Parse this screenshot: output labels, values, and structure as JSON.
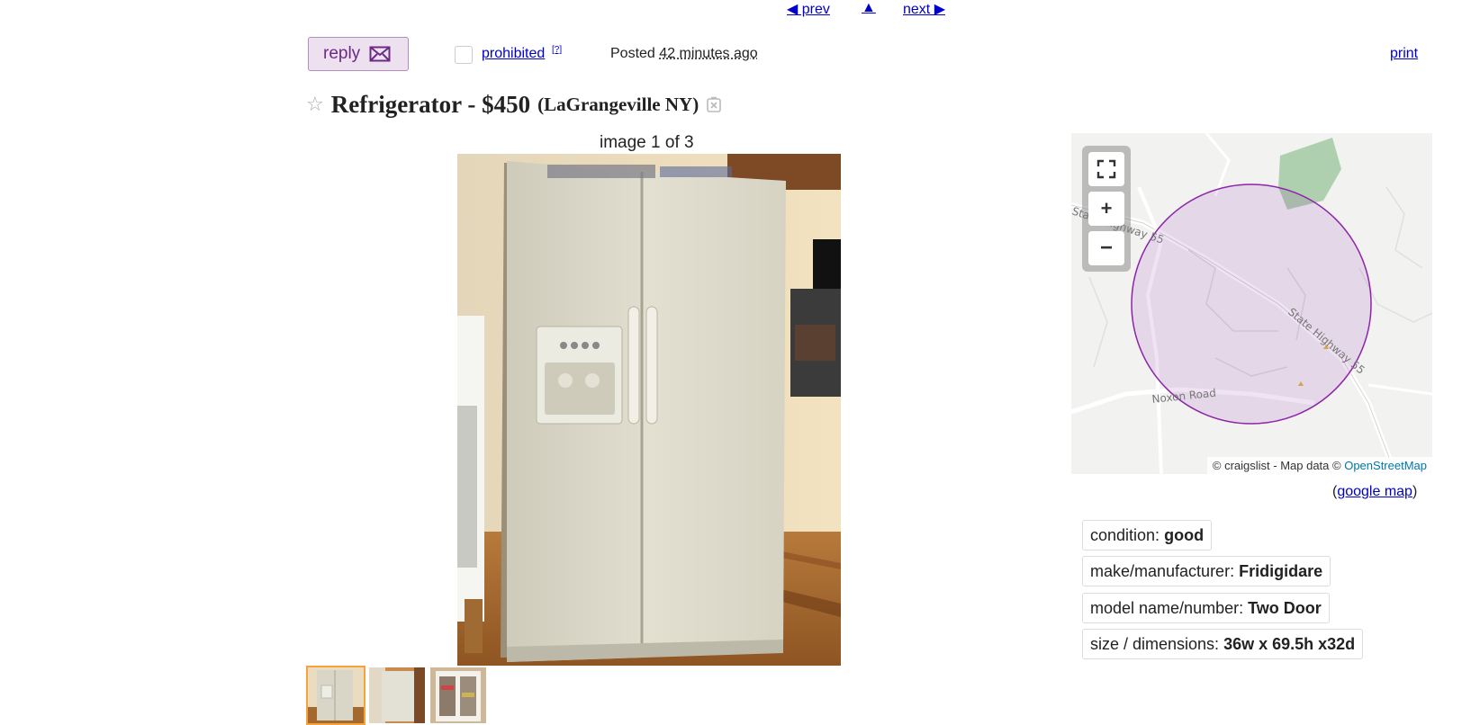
{
  "nav": {
    "prev": "◀ prev",
    "up": "▲",
    "next": "next ▶"
  },
  "header": {
    "reply_label": "reply",
    "prohibited_label": "prohibited",
    "help_label": "[?]",
    "posted_label": "Posted",
    "posted_when": "42 minutes ago",
    "print_label": "print"
  },
  "title": {
    "main": "Refrigerator - $450",
    "location": "(LaGrangeville NY)"
  },
  "gallery": {
    "counter": "image 1 of 3",
    "thumb_count": 3
  },
  "map": {
    "attribution_prefix": "© craigslist - Map data ©",
    "attribution_link": "OpenStreetMap",
    "road_labels": [
      "State Highway 55",
      "State Highway 55",
      "Noxon Road"
    ],
    "circle_color": "#8e24aa",
    "park_color": "#aed0ae"
  },
  "google_map": {
    "open": "(",
    "label": "google map",
    "close": ")"
  },
  "attributes": [
    {
      "key": "condition:",
      "value": "good"
    },
    {
      "key": "make/manufacturer:",
      "value": "Fridigidare"
    },
    {
      "key": "model name/number:",
      "value": "Two Door"
    },
    {
      "key": "size / dimensions:",
      "value": "36w x 69.5h x32d"
    }
  ]
}
